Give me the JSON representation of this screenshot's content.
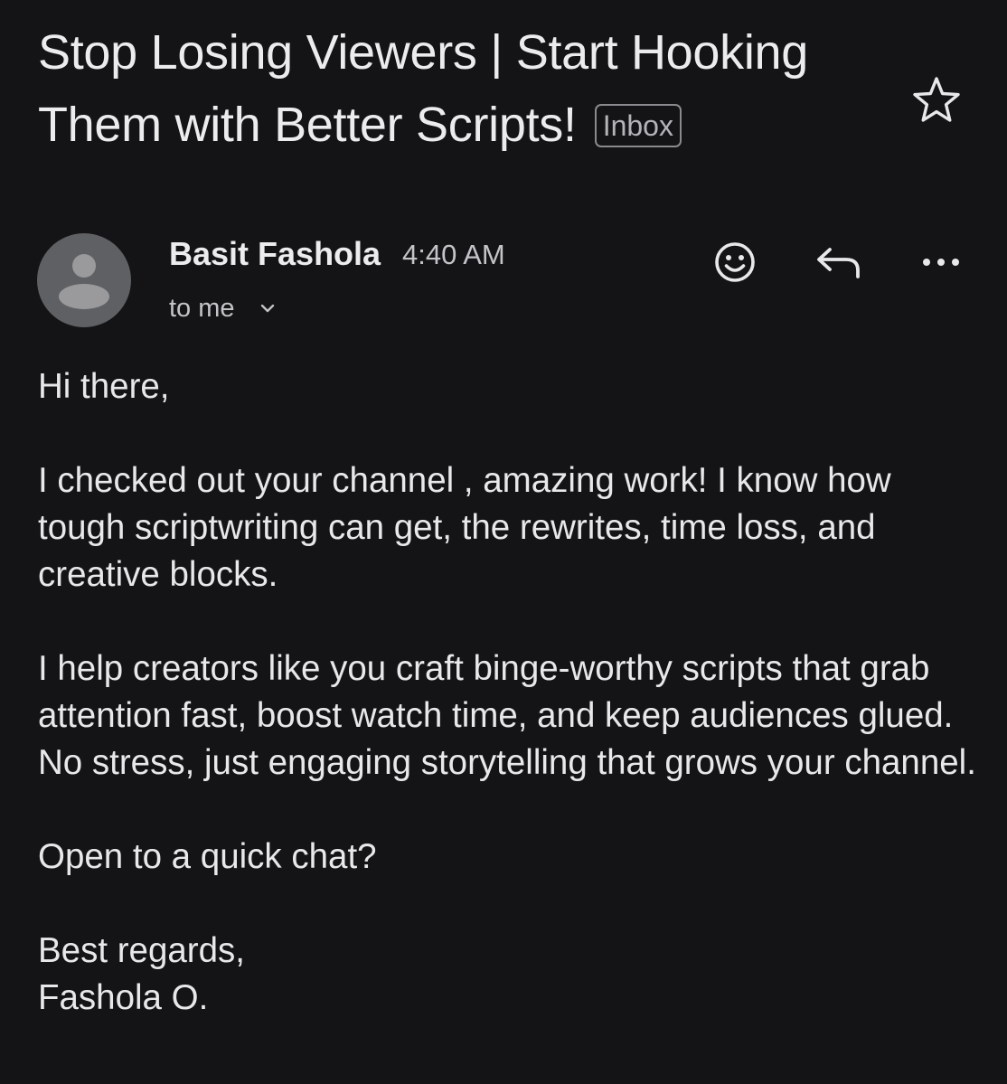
{
  "email": {
    "subject": "Stop Losing Viewers | Start Hooking Them with Better Scripts!",
    "label": "Inbox",
    "sender_name": "Basit Fashola",
    "time": "4:40 AM",
    "recipients": "to me",
    "icons": {
      "star": "star-icon",
      "avatar": "person-avatar-icon",
      "emoji": "smiley-icon",
      "reply": "reply-icon",
      "more": "more-horizontal-icon",
      "expand": "chevron-down-icon"
    },
    "body": {
      "greeting": "Hi there,",
      "paragraph_1": "I checked out your channel , amazing work! I know how tough scriptwriting can get, the rewrites, time loss, and creative blocks.",
      "paragraph_2": "I help creators like you craft binge-worthy scripts that grab attention fast, boost watch time, and keep audiences glued. No stress, just engaging storytelling that grows your channel.",
      "paragraph_3": "Open to a quick chat?",
      "closing": "Best regards,",
      "signature": "Fashola O."
    }
  },
  "colors": {
    "background": "#141416",
    "text_primary": "#ececee",
    "text_secondary": "#c4c4c8",
    "avatar_bg": "#5f6063",
    "avatar_fg": "#9a9a9d"
  }
}
